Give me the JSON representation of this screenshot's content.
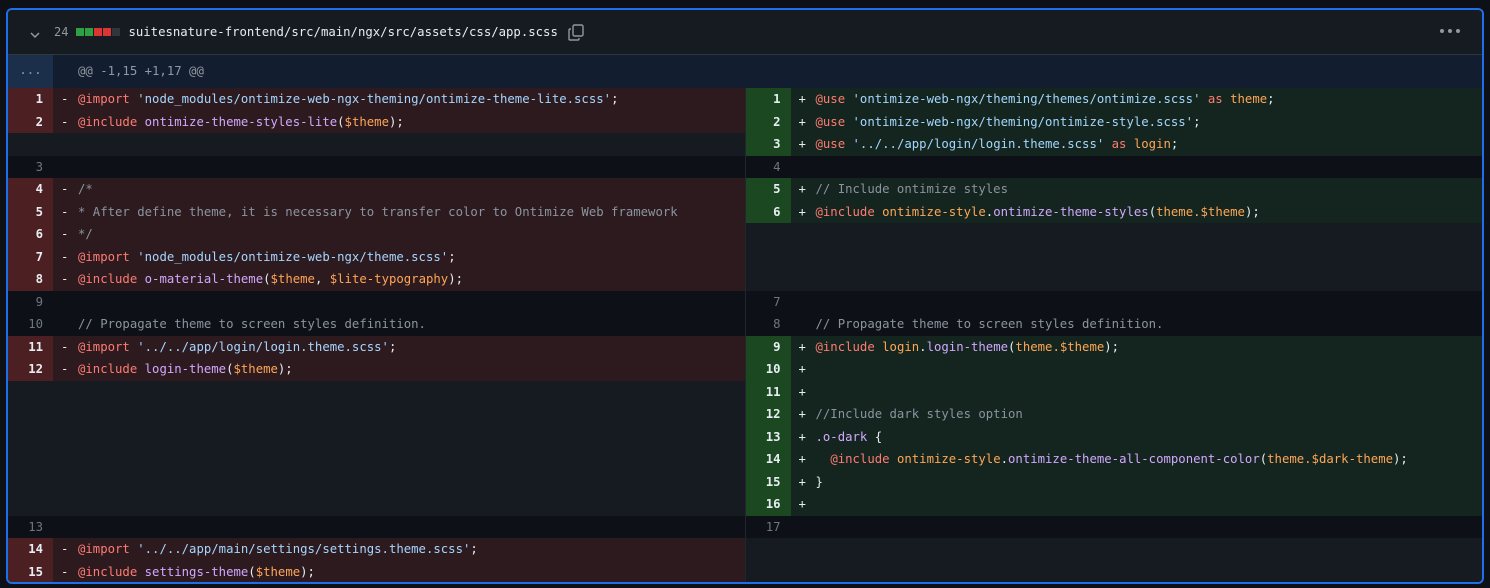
{
  "file": {
    "changes_count": "24",
    "diffstat": [
      "#2ea043",
      "#2ea043",
      "#da3633",
      "#da3633",
      "#30363d"
    ],
    "path": "suitesnature-frontend/src/main/ngx/src/assets/css/app.scss",
    "icons": {
      "collapse": "chevron-down-icon",
      "copy": "copy-icon",
      "menu": "kebab-horizontal-icon"
    }
  },
  "hunk": {
    "expand_label": "...",
    "header": "@@ -1,15 +1,17 @@"
  },
  "colors": {
    "accent": "#1f6feb",
    "deleted_bg": "#2d1a1f",
    "added_bg": "#13251e",
    "keyword": "#ff7b72",
    "string": "#a5d6ff",
    "function": "#d2a8ff",
    "variable": "#ffa657",
    "comment": "#8b949e"
  },
  "rows": [
    {
      "left": {
        "type": "del",
        "num": "1",
        "sign": "-",
        "tokens": [
          {
            "t": "@import",
            "c": "kw"
          },
          {
            "t": " ",
            "c": "pl"
          },
          {
            "t": "'node_modules/ontimize-web-ngx-theming/ontimize-theme-lite.scss'",
            "c": "str"
          },
          {
            "t": ";",
            "c": "pl"
          }
        ]
      },
      "right": {
        "type": "add",
        "num": "1",
        "sign": "+",
        "tokens": [
          {
            "t": "@use",
            "c": "kw"
          },
          {
            "t": " ",
            "c": "pl"
          },
          {
            "t": "'ontimize-web-ngx/theming/themes/ontimize.scss'",
            "c": "str"
          },
          {
            "t": " as ",
            "c": "kw"
          },
          {
            "t": "theme",
            "c": "var"
          },
          {
            "t": ";",
            "c": "pl"
          }
        ]
      }
    },
    {
      "left": {
        "type": "del",
        "num": "2",
        "sign": "-",
        "tokens": [
          {
            "t": "@include",
            "c": "kw"
          },
          {
            "t": " ",
            "c": "pl"
          },
          {
            "t": "ontimize-theme-styles-lite",
            "c": "fn"
          },
          {
            "t": "(",
            "c": "pl"
          },
          {
            "t": "$theme",
            "c": "var"
          },
          {
            "t": ");",
            "c": "pl"
          }
        ]
      },
      "right": {
        "type": "add",
        "num": "2",
        "sign": "+",
        "tokens": [
          {
            "t": "@use",
            "c": "kw"
          },
          {
            "t": " ",
            "c": "pl"
          },
          {
            "t": "'ontimize-web-ngx/theming/ontimize-style.scss'",
            "c": "str"
          },
          {
            "t": ";",
            "c": "pl"
          }
        ]
      }
    },
    {
      "left": {
        "type": "empty"
      },
      "right": {
        "type": "add",
        "num": "3",
        "sign": "+",
        "tokens": [
          {
            "t": "@use",
            "c": "kw"
          },
          {
            "t": " ",
            "c": "pl"
          },
          {
            "t": "'../../app/login/login.theme.scss'",
            "c": "str"
          },
          {
            "t": " as ",
            "c": "kw"
          },
          {
            "t": "login",
            "c": "var"
          },
          {
            "t": ";",
            "c": "pl"
          }
        ]
      }
    },
    {
      "left": {
        "type": "ctx",
        "num": "3",
        "sign": " ",
        "tokens": []
      },
      "right": {
        "type": "ctx",
        "num": "4",
        "sign": " ",
        "tokens": []
      }
    },
    {
      "left": {
        "type": "del",
        "num": "4",
        "sign": "-",
        "tokens": [
          {
            "t": "/*",
            "c": "cm"
          }
        ]
      },
      "right": {
        "type": "add",
        "num": "5",
        "sign": "+",
        "tokens": [
          {
            "t": "// Include ontimize styles",
            "c": "cm"
          }
        ]
      }
    },
    {
      "left": {
        "type": "del",
        "num": "5",
        "sign": "-",
        "tokens": [
          {
            "t": "* After define theme, it is necessary to transfer color to Ontimize Web framework",
            "c": "cm"
          }
        ]
      },
      "right": {
        "type": "add",
        "num": "6",
        "sign": "+",
        "tokens": [
          {
            "t": "@include",
            "c": "kw"
          },
          {
            "t": " ",
            "c": "pl"
          },
          {
            "t": "ontimize-style",
            "c": "var"
          },
          {
            "t": ".",
            "c": "pl"
          },
          {
            "t": "ontimize-theme-styles",
            "c": "fn"
          },
          {
            "t": "(",
            "c": "pl"
          },
          {
            "t": "theme.$theme",
            "c": "var"
          },
          {
            "t": ");",
            "c": "pl"
          }
        ]
      }
    },
    {
      "left": {
        "type": "del",
        "num": "6",
        "sign": "-",
        "tokens": [
          {
            "t": "*/",
            "c": "cm"
          }
        ]
      },
      "right": {
        "type": "empty"
      }
    },
    {
      "left": {
        "type": "del",
        "num": "7",
        "sign": "-",
        "tokens": [
          {
            "t": "@import",
            "c": "kw"
          },
          {
            "t": " ",
            "c": "pl"
          },
          {
            "t": "'node_modules/ontimize-web-ngx/theme.scss'",
            "c": "str"
          },
          {
            "t": ";",
            "c": "pl"
          }
        ]
      },
      "right": {
        "type": "empty"
      }
    },
    {
      "left": {
        "type": "del",
        "num": "8",
        "sign": "-",
        "tokens": [
          {
            "t": "@include",
            "c": "kw"
          },
          {
            "t": " ",
            "c": "pl"
          },
          {
            "t": "o-material-theme",
            "c": "fn"
          },
          {
            "t": "(",
            "c": "pl"
          },
          {
            "t": "$theme",
            "c": "var"
          },
          {
            "t": ", ",
            "c": "pl"
          },
          {
            "t": "$lite-typography",
            "c": "var"
          },
          {
            "t": ");",
            "c": "pl"
          }
        ]
      },
      "right": {
        "type": "empty"
      }
    },
    {
      "left": {
        "type": "ctx",
        "num": "9",
        "sign": " ",
        "tokens": []
      },
      "right": {
        "type": "ctx",
        "num": "7",
        "sign": " ",
        "tokens": []
      }
    },
    {
      "left": {
        "type": "ctx",
        "num": "10",
        "sign": " ",
        "tokens": [
          {
            "t": "// Propagate theme to screen styles definition.",
            "c": "cm"
          }
        ]
      },
      "right": {
        "type": "ctx",
        "num": "8",
        "sign": " ",
        "tokens": [
          {
            "t": "// Propagate theme to screen styles definition.",
            "c": "cm"
          }
        ]
      }
    },
    {
      "left": {
        "type": "del",
        "num": "11",
        "sign": "-",
        "tokens": [
          {
            "t": "@import",
            "c": "kw"
          },
          {
            "t": " ",
            "c": "pl"
          },
          {
            "t": "'../../app/login/login.theme.scss'",
            "c": "str"
          },
          {
            "t": ";",
            "c": "pl"
          }
        ]
      },
      "right": {
        "type": "add",
        "num": "9",
        "sign": "+",
        "tokens": [
          {
            "t": "@include",
            "c": "kw"
          },
          {
            "t": " ",
            "c": "pl"
          },
          {
            "t": "login",
            "c": "var"
          },
          {
            "t": ".",
            "c": "pl"
          },
          {
            "t": "login-theme",
            "c": "fn"
          },
          {
            "t": "(",
            "c": "pl"
          },
          {
            "t": "theme.$theme",
            "c": "var"
          },
          {
            "t": ");",
            "c": "pl"
          }
        ]
      }
    },
    {
      "left": {
        "type": "del",
        "num": "12",
        "sign": "-",
        "tokens": [
          {
            "t": "@include",
            "c": "kw"
          },
          {
            "t": " ",
            "c": "pl"
          },
          {
            "t": "login-theme",
            "c": "fn"
          },
          {
            "t": "(",
            "c": "pl"
          },
          {
            "t": "$theme",
            "c": "var"
          },
          {
            "t": ");",
            "c": "pl"
          }
        ]
      },
      "right": {
        "type": "add",
        "num": "10",
        "sign": "+",
        "tokens": []
      }
    },
    {
      "left": {
        "type": "empty"
      },
      "right": {
        "type": "add",
        "num": "11",
        "sign": "+",
        "tokens": []
      }
    },
    {
      "left": {
        "type": "empty"
      },
      "right": {
        "type": "add",
        "num": "12",
        "sign": "+",
        "tokens": [
          {
            "t": "//Include dark styles option",
            "c": "cm"
          }
        ]
      }
    },
    {
      "left": {
        "type": "empty"
      },
      "right": {
        "type": "add",
        "num": "13",
        "sign": "+",
        "tokens": [
          {
            "t": ".o-dark",
            "c": "fn"
          },
          {
            "t": " {",
            "c": "pl"
          }
        ]
      }
    },
    {
      "left": {
        "type": "empty"
      },
      "right": {
        "type": "add",
        "num": "14",
        "sign": "+",
        "tokens": [
          {
            "t": "  ",
            "c": "pl"
          },
          {
            "t": "@include",
            "c": "kw"
          },
          {
            "t": " ",
            "c": "pl"
          },
          {
            "t": "ontimize-style",
            "c": "var"
          },
          {
            "t": ".",
            "c": "pl"
          },
          {
            "t": "ontimize-theme-all-component-color",
            "c": "fn"
          },
          {
            "t": "(",
            "c": "pl"
          },
          {
            "t": "theme.$dark-theme",
            "c": "var"
          },
          {
            "t": ");",
            "c": "pl"
          }
        ]
      }
    },
    {
      "left": {
        "type": "empty"
      },
      "right": {
        "type": "add",
        "num": "15",
        "sign": "+",
        "tokens": [
          {
            "t": "}",
            "c": "pl"
          }
        ]
      }
    },
    {
      "left": {
        "type": "empty"
      },
      "right": {
        "type": "add",
        "num": "16",
        "sign": "+",
        "tokens": []
      }
    },
    {
      "left": {
        "type": "ctx",
        "num": "13",
        "sign": " ",
        "tokens": []
      },
      "right": {
        "type": "ctx",
        "num": "17",
        "sign": " ",
        "tokens": []
      }
    },
    {
      "left": {
        "type": "del",
        "num": "14",
        "sign": "-",
        "tokens": [
          {
            "t": "@import",
            "c": "kw"
          },
          {
            "t": " ",
            "c": "pl"
          },
          {
            "t": "'../../app/main/settings/settings.theme.scss'",
            "c": "str"
          },
          {
            "t": ";",
            "c": "pl"
          }
        ]
      },
      "right": {
        "type": "empty"
      }
    },
    {
      "left": {
        "type": "del",
        "num": "15",
        "sign": "-",
        "tokens": [
          {
            "t": "@include",
            "c": "kw"
          },
          {
            "t": " ",
            "c": "pl"
          },
          {
            "t": "settings-theme",
            "c": "fn"
          },
          {
            "t": "(",
            "c": "pl"
          },
          {
            "t": "$theme",
            "c": "var"
          },
          {
            "t": ");",
            "c": "pl"
          }
        ]
      },
      "right": {
        "type": "empty"
      }
    }
  ]
}
